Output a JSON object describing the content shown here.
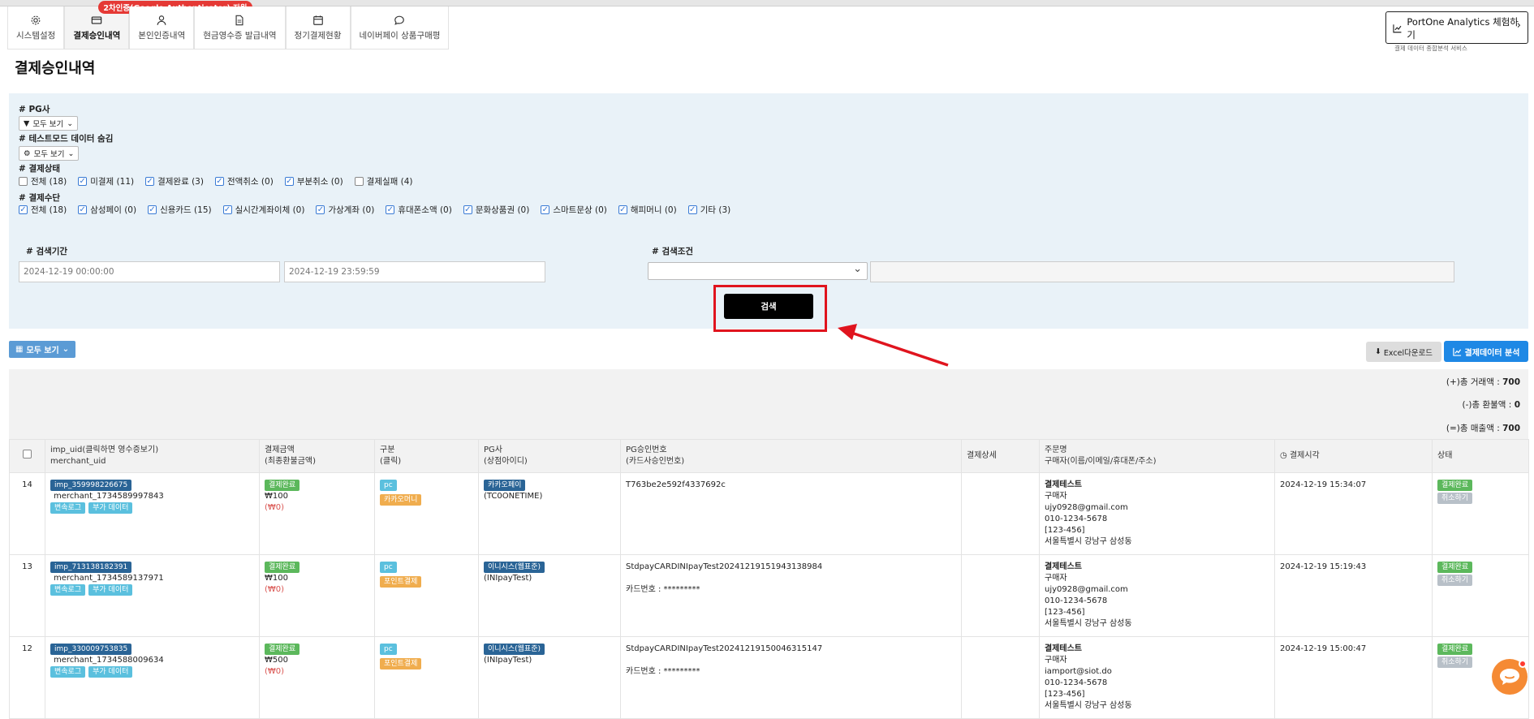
{
  "tabs": [
    {
      "label": "시스템설정",
      "icon": "gear-icon"
    },
    {
      "label": "결제승인내역",
      "icon": "card-icon",
      "active": true,
      "badge": "2차인증(Google Authenticator) 지원"
    },
    {
      "label": "본인인증내역",
      "icon": "person-icon"
    },
    {
      "label": "현금영수증 발급내역",
      "icon": "document-icon"
    },
    {
      "label": "정기결제현황",
      "icon": "calendar-icon"
    },
    {
      "label": "네이버페이 상품구매평",
      "icon": "chat-icon"
    }
  ],
  "analytics": {
    "title": "PortOne Analytics 체험하기",
    "subtitle": "결제 데이터 종합분석 서비스"
  },
  "page_title": "결제승인내역",
  "filters": {
    "pg_label": "# PG사",
    "pg_button": "모두 보기",
    "test_label": "# 테스트모드 데이터 숨김",
    "test_button": "모두 보기",
    "status_label": "# 결제상태",
    "status_items": [
      {
        "label": "전체 (18)",
        "checked": false
      },
      {
        "label": "미결제 (11)",
        "checked": true
      },
      {
        "label": "결제완료 (3)",
        "checked": true
      },
      {
        "label": "전액취소 (0)",
        "checked": true
      },
      {
        "label": "부분취소 (0)",
        "checked": true
      },
      {
        "label": "결제실패 (4)",
        "checked": false
      }
    ],
    "method_label": "# 결제수단",
    "method_items": [
      {
        "label": "전체 (18)",
        "checked": true
      },
      {
        "label": "삼성페이 (0)",
        "checked": true
      },
      {
        "label": "신용카드 (15)",
        "checked": true
      },
      {
        "label": "실시간계좌이체 (0)",
        "checked": true
      },
      {
        "label": "가상계좌 (0)",
        "checked": true
      },
      {
        "label": "휴대폰소액 (0)",
        "checked": true
      },
      {
        "label": "문화상품권 (0)",
        "checked": true
      },
      {
        "label": "스마트문상 (0)",
        "checked": true
      },
      {
        "label": "해피머니 (0)",
        "checked": true
      },
      {
        "label": "기타 (3)",
        "checked": true
      }
    ],
    "period_label": "# 검색기간",
    "period_start": "2024-12-19 00:00:00",
    "period_end": "2024-12-19 23:59:59",
    "condition_label": "# 검색조건",
    "search_button": "검색"
  },
  "toolbar": {
    "view_all": "모두 보기",
    "excel": "Excel다운로드",
    "analysis": "결제데이터 분석"
  },
  "summary": {
    "total_label": "(+)총 거래액 :",
    "total_value": "700",
    "refund_label": "(-)총 환불액 :",
    "refund_value": "0",
    "net_label": "(=)총 매출액 :",
    "net_value": "700"
  },
  "table": {
    "headers": {
      "uid": "imp_uid(클릭하면 영수증보기)",
      "uid_sub": "merchant_uid",
      "amount": "결제금액",
      "amount_sub": "(최종환불금액)",
      "type": "구분",
      "type_sub": "(클릭)",
      "pg": "PG사",
      "pg_sub": "(상점아이디)",
      "approval": "PG승인번호",
      "approval_sub": "(카드사승인번호)",
      "detail": "결제상세",
      "orderer": "주문명",
      "orderer_sub": "구매자(이름/이메일/휴대폰/주소)",
      "time": "결제시각",
      "status": "상태"
    },
    "rows": [
      {
        "no": "14",
        "imp_uid": "imp_359998226675",
        "merchant_uid": "merchant_1734589997843",
        "tag1": "변속로그",
        "tag2": "부가 데이터",
        "amount_status": "결제완료",
        "amount": "₩100",
        "refund": "(₩0)",
        "device": "pc",
        "method": "카카오머니",
        "pg": "카카오페이",
        "pg_id": "(TC0ONETIME)",
        "approval": "T763be2e592f4337692c",
        "card_no": "",
        "order_name": "결제테스트",
        "buyer": "구매자",
        "email": "ujy0928@gmail.com",
        "phone": "010-1234-5678",
        "zip": "[123-456]",
        "address": "서울특별시 강남구 삼성동",
        "time": "2024-12-19 15:34:07",
        "status": "결제완료",
        "cancel": "취소하기"
      },
      {
        "no": "13",
        "imp_uid": "imp_713138182391",
        "merchant_uid": "merchant_1734589137971",
        "tag1": "변속로그",
        "tag2": "부가 데이터",
        "amount_status": "결제완료",
        "amount": "₩100",
        "refund": "(₩0)",
        "device": "pc",
        "method": "포인트결제",
        "pg": "이니시스(웹표준)",
        "pg_id": "(INIpayTest)",
        "approval": "StdpayCARDINIpayTest20241219151943138984",
        "card_no": "카드번호 : *********",
        "order_name": "결제테스트",
        "buyer": "구매자",
        "email": "ujy0928@gmail.com",
        "phone": "010-1234-5678",
        "zip": "[123-456]",
        "address": "서울특별시 강남구 삼성동",
        "time": "2024-12-19 15:19:43",
        "status": "결제완료",
        "cancel": "취소하기"
      },
      {
        "no": "12",
        "imp_uid": "imp_330009753835",
        "merchant_uid": "merchant_1734588009634",
        "tag1": "변속로그",
        "tag2": "부가 데이터",
        "amount_status": "결제완료",
        "amount": "₩500",
        "refund": "(₩0)",
        "device": "pc",
        "method": "포인트결제",
        "pg": "이니시스(웹표준)",
        "pg_id": "(INIpayTest)",
        "approval": "StdpayCARDINIpayTest20241219150046315147",
        "card_no": "카드번호 : *********",
        "order_name": "결제테스트",
        "buyer": "구매자",
        "email": "iamport@siot.do",
        "phone": "010-1234-5678",
        "zip": "[123-456]",
        "address": "서울특별시 강남구 삼성동",
        "time": "2024-12-19 15:00:47",
        "status": "결제완료",
        "cancel": "취소하기"
      }
    ]
  }
}
